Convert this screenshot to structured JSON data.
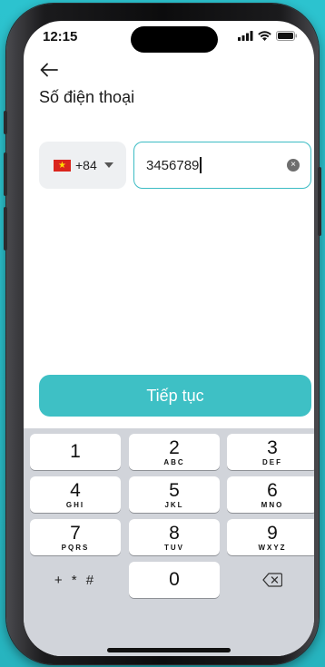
{
  "status_bar": {
    "time": "12:15"
  },
  "header": {
    "title": "Số điện thoại"
  },
  "phone_form": {
    "country_code": "+84",
    "phone_value": "3456789",
    "clear_symbol": "×"
  },
  "continue_label": "Tiếp tục",
  "keyboard": {
    "keys": [
      {
        "digit": "1",
        "letters": ""
      },
      {
        "digit": "2",
        "letters": "ABC"
      },
      {
        "digit": "3",
        "letters": "DEF"
      },
      {
        "digit": "4",
        "letters": "GHI"
      },
      {
        "digit": "5",
        "letters": "JKL"
      },
      {
        "digit": "6",
        "letters": "MNO"
      },
      {
        "digit": "7",
        "letters": "PQRS"
      },
      {
        "digit": "8",
        "letters": "TUV"
      },
      {
        "digit": "9",
        "letters": "WXYZ"
      }
    ],
    "symbols": "+ * #",
    "zero": "0"
  },
  "colors": {
    "accent": "#3ec0c5",
    "background": "#2cc3cf",
    "keyboard": "#d1d4da"
  },
  "icons": [
    "back-arrow-icon",
    "vietnam-flag-icon",
    "caret-down-icon",
    "clear-icon",
    "backspace-icon",
    "signal-icon",
    "wifi-icon",
    "battery-icon"
  ]
}
